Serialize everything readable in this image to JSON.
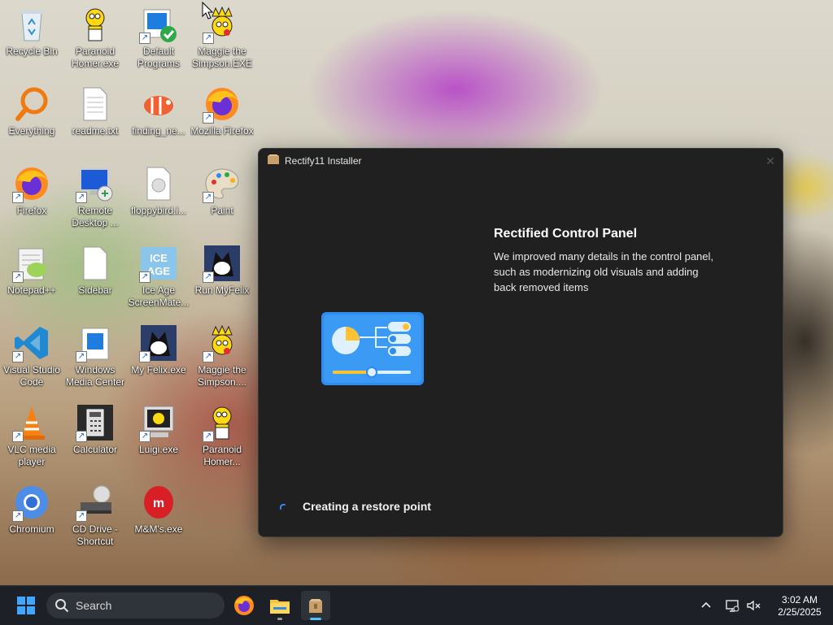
{
  "desktop": {
    "icons": [
      {
        "label": "Recycle Bin"
      },
      {
        "label": "Paranoid Homer.exe"
      },
      {
        "label": "Default Programs"
      },
      {
        "label": "Maggie the Simpson.EXE"
      },
      {
        "label": "Everything"
      },
      {
        "label": "readme.txt"
      },
      {
        "label": "finding_ne..."
      },
      {
        "label": "Mozilla Firefox"
      },
      {
        "label": "Firefox"
      },
      {
        "label": "Remote Desktop ..."
      },
      {
        "label": "floppybird.i..."
      },
      {
        "label": "Paint"
      },
      {
        "label": "Notepad++"
      },
      {
        "label": "Sidebar"
      },
      {
        "label": "Ice Age ScreenMate..."
      },
      {
        "label": "Run MyFelix"
      },
      {
        "label": "Visual Studio Code"
      },
      {
        "label": "Windows Media Center"
      },
      {
        "label": "My Felix.exe"
      },
      {
        "label": "Maggie the Simpson...."
      },
      {
        "label": "VLC media player"
      },
      {
        "label": "Calculator"
      },
      {
        "label": "Luigi.exe"
      },
      {
        "label": "Paranoid Homer..."
      },
      {
        "label": "Chromium"
      },
      {
        "label": "CD Drive - Shortcut"
      },
      {
        "label": "M&M's.exe"
      }
    ]
  },
  "window": {
    "title": "Rectify11 Installer",
    "close_glyph": "✕",
    "feature_title": "Rectified Control Panel",
    "feature_description": "We improved many details in the control panel, such as modernizing old visuals and adding back removed items",
    "status": "Creating a restore point"
  },
  "taskbar": {
    "search_placeholder": "Search",
    "time": "3:02 AM",
    "date": "2/25/2025"
  },
  "colors": {
    "window_bg": "#202020",
    "accent": "#2f8cf0",
    "taskbar_bg": "#1d2127"
  }
}
